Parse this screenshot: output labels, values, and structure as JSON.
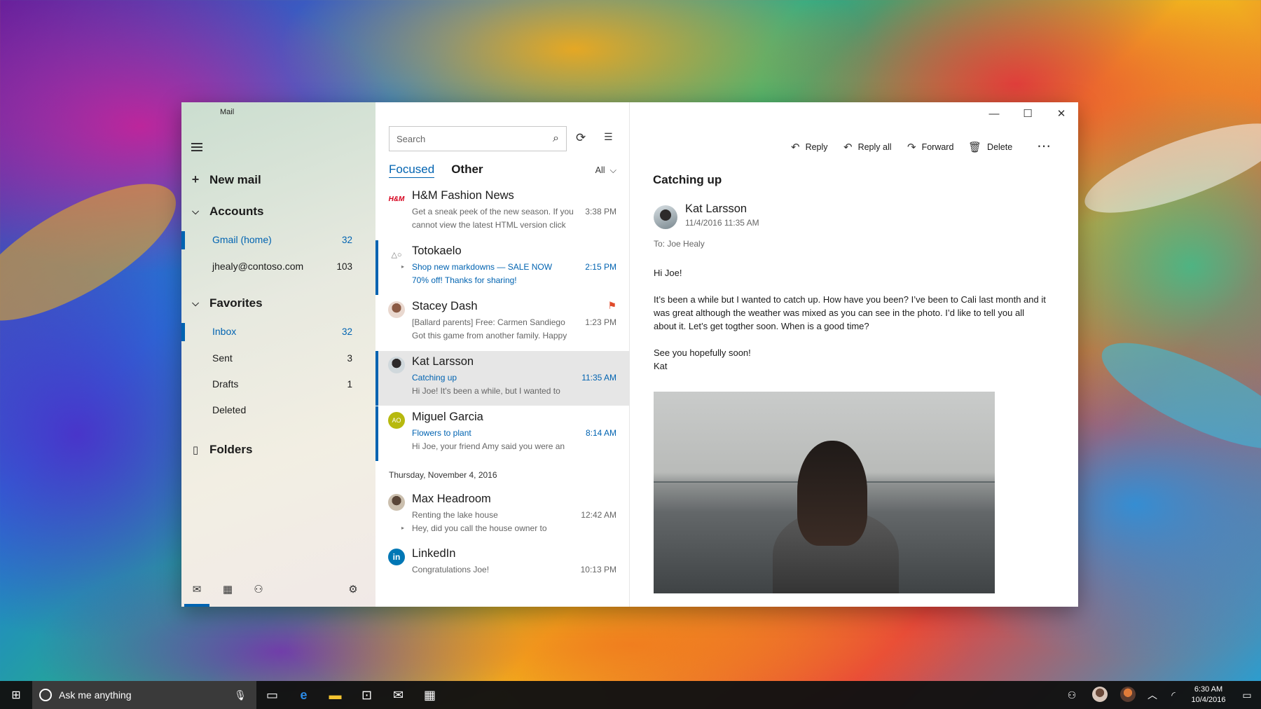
{
  "app": {
    "title": "Mail"
  },
  "nav": {
    "new_mail": "New mail",
    "accounts_header": "Accounts",
    "accounts": [
      {
        "label": "Gmail (home)",
        "count": "32"
      },
      {
        "label": "jhealy@contoso.com",
        "count": "103"
      }
    ],
    "favorites_header": "Favorites",
    "favorites": [
      {
        "label": "Inbox",
        "count": "32"
      },
      {
        "label": "Sent",
        "count": "3"
      },
      {
        "label": "Drafts",
        "count": "1"
      },
      {
        "label": "Deleted",
        "count": ""
      }
    ],
    "folders": "Folders"
  },
  "list": {
    "search_placeholder": "Search",
    "tab_focused": "Focused",
    "tab_other": "Other",
    "filter": "All",
    "messages": [
      {
        "sender": "H&M Fashion News",
        "subject": "",
        "preview1": "Get a sneak peek of the new season. If you",
        "preview2": "cannot view the latest HTML version click",
        "time": "3:38 PM",
        "avatar": "H&M"
      },
      {
        "sender": "Totokaelo",
        "subject": "Shop new markdowns — SALE NOW",
        "preview1": "70% off! Thanks for sharing!",
        "time": "2:15 PM",
        "avatar": "△○"
      },
      {
        "sender": "Stacey Dash",
        "subject": "[Ballard parents] Free: Carmen Sandiego",
        "preview1": "Got this game from another family. Happy",
        "time": "1:23 PM"
      },
      {
        "sender": "Kat Larsson",
        "subject": "Catching up",
        "preview1": "Hi Joe! It's been a while, but I wanted to",
        "time": "11:35 AM"
      },
      {
        "sender": "Miguel Garcia",
        "subject": "Flowers to plant",
        "preview1": "Hi Joe, your friend Amy said you were an",
        "time": "8:14 AM",
        "avatar": "AO"
      },
      {
        "sender": "Max Headroom",
        "subject": "Renting the lake house",
        "preview1": "Hey, did you call the house owner to",
        "time": "12:42 AM"
      },
      {
        "sender": "LinkedIn",
        "subject": "Congratulations Joe!",
        "preview1": "",
        "time": "10:13 PM",
        "avatar": "in"
      }
    ],
    "date_header": "Thursday, November 4, 2016"
  },
  "reading": {
    "commands": {
      "reply": "Reply",
      "reply_all": "Reply all",
      "forward": "Forward",
      "delete": "Delete"
    },
    "subject": "Catching up",
    "from": "Kat Larsson",
    "date": "11/4/2016 11:35 AM",
    "to": "To: Joe Healy",
    "body": [
      "Hi Joe!",
      "It’s been a while but I wanted to catch up. How have you been? I’ve been to Cali last month and it was great although the weather was mixed as you can see in the photo. I’d like to tell you all about it. Let’s get togther soon. When is a good time?",
      "See you hopefully soon!",
      "Kat"
    ]
  },
  "taskbar": {
    "search_placeholder": "Ask me anything",
    "time": "6:30 AM",
    "date": "10/4/2016"
  },
  "colors": {
    "accent": "#0063b1",
    "flag": "#e04a2a"
  }
}
